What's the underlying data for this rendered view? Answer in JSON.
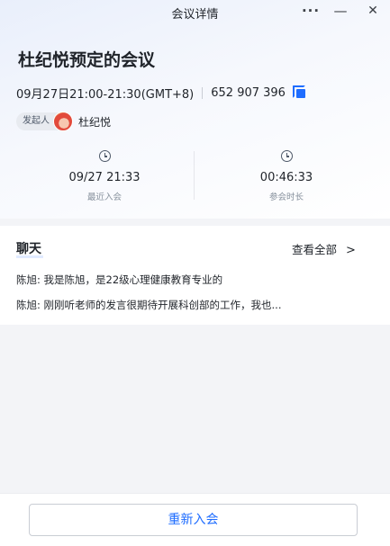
{
  "window": {
    "title": "会议详情",
    "more": "···",
    "minimize": "—",
    "close": "✕"
  },
  "meeting": {
    "title": "杜纪悦预定的会议",
    "time": "09月27日21:00-21:30(GMT+8)",
    "meeting_id": "652 907 396",
    "organizer_label": "发起人",
    "organizer_name": "杜纪悦"
  },
  "stats": {
    "last_join_value": "09/27 21:33",
    "last_join_label": "最近入会",
    "duration_value": "00:46:33",
    "duration_label": "参会时长"
  },
  "chat": {
    "title": "聊天",
    "view_all": "查看全部",
    "chevron": ">",
    "messages": [
      "陈旭: 我是陈旭，是22级心理健康教育专业的",
      "陈旭: 刚刚听老师的发言很期待开展科创部的工作，我也..."
    ]
  },
  "footer": {
    "rejoin_label": "重新入会"
  },
  "colors": {
    "accent": "#1f6dff",
    "background": "#f3f4f7"
  }
}
